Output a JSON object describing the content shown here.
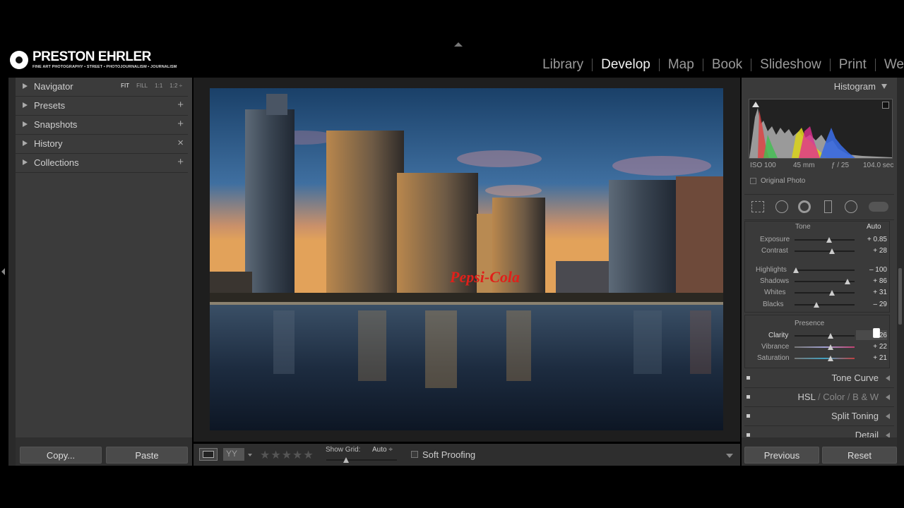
{
  "branding": {
    "name": "PRESTON EHRLER",
    "tagline": "FINE ART PHOTOGRAPHY • STREET • PHOTOJOURNALISM • JOURNALISM"
  },
  "modules": [
    "Library",
    "Develop",
    "Map",
    "Book",
    "Slideshow",
    "Print",
    "We"
  ],
  "active_module": "Develop",
  "left_panel": {
    "navigator": {
      "label": "Navigator",
      "options": [
        "FIT",
        "FILL",
        "1:1",
        "1:2 ÷"
      ]
    },
    "presets_label": "Presets",
    "snapshots_label": "Snapshots",
    "history_label": "History",
    "collections_label": "Collections",
    "plus": "+",
    "close": "×",
    "copy_label": "Copy...",
    "paste_label": "Paste"
  },
  "toolbar": {
    "show_grid_label": "Show Grid:",
    "show_grid_value": "Auto ÷",
    "soft_proofing_label": "Soft Proofing",
    "stars": "★★★★★",
    "rating": 0
  },
  "right_panel": {
    "histogram_label": "Histogram",
    "exif": {
      "iso": "ISO 100",
      "focal": "45 mm",
      "aperture": "ƒ / 25",
      "shutter": "104.0 sec"
    },
    "original_photo_label": "Original Photo",
    "tone_label": "Tone",
    "auto_label": "Auto",
    "presence_label": "Presence",
    "sliders": {
      "exposure": {
        "label": "Exposure",
        "value": "+ 0.85",
        "position": 0.58
      },
      "contrast": {
        "label": "Contrast",
        "value": "+ 28",
        "position": 0.62
      },
      "highlights": {
        "label": "Highlights",
        "value": "– 100",
        "position": 0.02
      },
      "shadows": {
        "label": "Shadows",
        "value": "+ 86",
        "position": 0.88
      },
      "whites": {
        "label": "Whites",
        "value": "+ 31",
        "position": 0.62
      },
      "blacks": {
        "label": "Blacks",
        "value": "– 29",
        "position": 0.36
      },
      "clarity": {
        "label": "Clarity",
        "value": "26",
        "position": 0.6
      },
      "vibrance": {
        "label": "Vibrance",
        "value": "+ 22",
        "position": 0.6
      },
      "saturation": {
        "label": "Saturation",
        "value": "+ 21",
        "position": 0.6
      }
    },
    "sections": {
      "tone_curve": "Tone Curve",
      "hsl": "HSL",
      "color": "Color",
      "bw": "B & W",
      "split_toning": "Split Toning",
      "detail": "Detail",
      "slash": "/"
    },
    "previous_label": "Previous",
    "reset_label": "Reset"
  },
  "photo": {
    "sign_text": "Pepsi-Cola"
  },
  "colors": {
    "panel_bg": "#3b3b3b",
    "background": "#000000",
    "accent_text": "#f2f2f2",
    "sign_red": "#e0201a"
  }
}
